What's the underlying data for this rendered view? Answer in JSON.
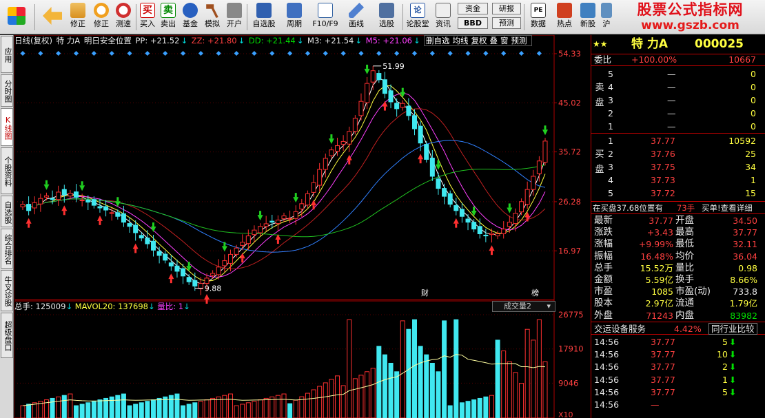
{
  "toolbar": {
    "buttons": [
      {
        "name": "menu-logo-button",
        "label": "",
        "icon": "windows-logo-icon"
      },
      {
        "name": "back-button",
        "label": "",
        "icon": "back-arrow-icon"
      },
      {
        "name": "revise-button",
        "label": "修正",
        "icon": "updown-arrow-icon"
      },
      {
        "name": "revise2-button",
        "label": "修正",
        "icon": "clock-face-icon"
      },
      {
        "name": "speed-test-button",
        "label": "测速",
        "icon": "stopwatch-icon"
      },
      {
        "name": "buy-button",
        "label": "买入",
        "icon": "buy-icon"
      },
      {
        "name": "sell-button",
        "label": "卖出",
        "icon": "sell-icon"
      },
      {
        "name": "fund-button",
        "label": "基金",
        "icon": "fund-icon"
      },
      {
        "name": "simulate-button",
        "label": "模拟",
        "icon": "hammer-icon"
      },
      {
        "name": "open-account-button",
        "label": "开户",
        "icon": "lock-icon"
      },
      {
        "name": "watchlist-button",
        "label": "自选股",
        "icon": "star-icon"
      },
      {
        "name": "period-button",
        "label": "周期",
        "icon": "candle-icon"
      },
      {
        "name": "f10-button",
        "label": "F10/F9",
        "icon": "document-icon"
      },
      {
        "name": "draw-line-button",
        "label": "画线",
        "icon": "pencil-icon"
      },
      {
        "name": "stock-select-button",
        "label": "选股",
        "icon": "screen-icon"
      },
      {
        "name": "forum-button",
        "label": "论股堂",
        "icon": "forum-icon"
      },
      {
        "name": "news-button",
        "label": "资讯",
        "icon": "news-icon"
      },
      {
        "name": "research-button",
        "label": "研报",
        "icon": "report-icon"
      },
      {
        "name": "forecast-button",
        "label": "预测",
        "icon": "forecast-icon"
      },
      {
        "name": "data-button",
        "label": "数据",
        "icon": "pe-icon"
      },
      {
        "name": "hot-button",
        "label": "热点",
        "icon": "temple-icon"
      },
      {
        "name": "new-stock-button",
        "label": "新股",
        "icon": "new-stock-icon"
      },
      {
        "name": "more-button",
        "label": "沪",
        "icon": "more-icon"
      }
    ],
    "fund_label": "资金",
    "bbd_label": "BBD",
    "banner_title": "股票公式指标网",
    "banner_url": "www.gszb.com"
  },
  "left_tabs": [
    "应用",
    "分时图",
    "K线图",
    "个股资料",
    "自选股",
    "综合排名",
    "牛叉诊股",
    "超级盘口"
  ],
  "chart": {
    "header": {
      "title": "日线(复权)",
      "stock": "特 力A",
      "indicator": "明日安全位置",
      "pp": "PP: +21.52",
      "zz": "ZZ: +21.80",
      "dd": "DD: +21.44",
      "m3": "M3: +21.54",
      "m5": "M5: +21.06",
      "tail": "M"
    },
    "tools": [
      "删自选",
      "均线",
      "复权",
      "叠",
      "窗",
      "预测"
    ],
    "price_axis": [
      "54.33",
      "45.02",
      "35.72",
      "26.28",
      "16.97"
    ],
    "high_label": "51.99",
    "low_label": "9.88",
    "fin_label": "财",
    "rank_label": "榜",
    "volume": {
      "total": "总手: 125009",
      "mavol": "MAVOL20: 137698",
      "ratio": "量比: 1",
      "selector": "成交量2",
      "axis": [
        "26775",
        "17910",
        "9046",
        "X10"
      ]
    }
  },
  "chart_data": {
    "type": "candlestick",
    "note_series": [
      "MA5",
      "MA10",
      "MA20",
      "MA30",
      "MA60",
      "MA120"
    ],
    "close": [
      25.8,
      24.6,
      26.1,
      26.9,
      27.4,
      26.7,
      28.1,
      27.6,
      27.9,
      27.1,
      26.6,
      26.2,
      25.6,
      25.1,
      24.7,
      24.2,
      23.5,
      22.4,
      21.6,
      20.4,
      19.4,
      18.3,
      17.1,
      16.1,
      15.2,
      14.1,
      13.1,
      12.2,
      11.1,
      10.3,
      10.8,
      11.8,
      12.7,
      13.9,
      15.1,
      16.3,
      17.5,
      18.6,
      19.8,
      20.9,
      21.6,
      22.1,
      22.4,
      22.8,
      23.6,
      23.1,
      24.4,
      25.9,
      27.8,
      29.9,
      32.4,
      34.5,
      36.1,
      36.9,
      37.7,
      39.6,
      42.1,
      45.3,
      48.7,
      51.1,
      49.4,
      46.8,
      45.2,
      43.9,
      44.9,
      42.6,
      40.1,
      37.4,
      34.3,
      31.1,
      28.8,
      27.3,
      25.8,
      24.6,
      23.5,
      22.4,
      21.1,
      20.2,
      19.8,
      20.3,
      20.2,
      21.1,
      22.4,
      24.1,
      26.3,
      28.6,
      31.1,
      34.0,
      37.77
    ],
    "last": 37.77
  },
  "panel": {
    "header": {
      "stars": "★★",
      "name": "特 力A",
      "code": "000025"
    },
    "weibi": {
      "label": "委比",
      "value": "+100.00%",
      "diff": "10667"
    },
    "sell": [
      {
        "level": "5",
        "price": "—",
        "vol": "0"
      },
      {
        "level": "4",
        "price": "—",
        "vol": "0"
      },
      {
        "level": "3",
        "price": "—",
        "vol": "0"
      },
      {
        "level": "2",
        "price": "—",
        "vol": "0"
      },
      {
        "level": "1",
        "price": "—",
        "vol": "0"
      }
    ],
    "sell_side": "卖盘",
    "buy": [
      {
        "level": "1",
        "price": "37.77",
        "vol": "10592"
      },
      {
        "level": "2",
        "price": "37.76",
        "vol": "25"
      },
      {
        "level": "3",
        "price": "37.75",
        "vol": "34"
      },
      {
        "level": "4",
        "price": "37.73",
        "vol": "1"
      },
      {
        "level": "5",
        "price": "37.72",
        "vol": "15"
      }
    ],
    "buy_side": "买盘",
    "orderbar": {
      "text": "在买盘37.68位置有",
      "hands": "73手",
      "action": "买单!查看详细"
    },
    "quote": [
      {
        "l1": "最新",
        "v1": "37.77",
        "l2": "开盘",
        "v2": "34.50"
      },
      {
        "l1": "涨跌",
        "v1": "+3.43",
        "l2": "最高",
        "v2": "37.77"
      },
      {
        "l1": "涨幅",
        "v1": "+9.99%",
        "l2": "最低",
        "v2": "32.11"
      },
      {
        "l1": "振幅",
        "v1": "16.48%",
        "l2": "均价",
        "v2": "36.04"
      },
      {
        "l1": "总手",
        "v1": "15.52万",
        "l2": "量比",
        "v2": "0.98"
      },
      {
        "l1": "金额",
        "v1": "5.59亿",
        "l2": "换手",
        "v2": "8.66%"
      },
      {
        "l1": "市盈",
        "v1": "1085",
        "l2": "市盈(动)",
        "v2": "733.8"
      },
      {
        "l1": "股本",
        "v1": "2.97亿",
        "l2": "流通",
        "v2": "1.79亿"
      },
      {
        "l1": "外盘",
        "v1": "71243",
        "l2": "内盘",
        "v2": "83982"
      }
    ],
    "industry": {
      "name": "交运设备服务",
      "pct": "4.42%",
      "compare": "同行业比较"
    },
    "ticks": [
      {
        "time": "14:56",
        "price": "37.77",
        "vol": "5"
      },
      {
        "time": "14:56",
        "price": "37.77",
        "vol": "10"
      },
      {
        "time": "14:56",
        "price": "37.77",
        "vol": "2"
      },
      {
        "time": "14:56",
        "price": "37.77",
        "vol": "1"
      },
      {
        "time": "14:56",
        "price": "37.77",
        "vol": "5"
      },
      {
        "time": "14:56",
        "price": "—",
        "vol": ""
      }
    ]
  }
}
